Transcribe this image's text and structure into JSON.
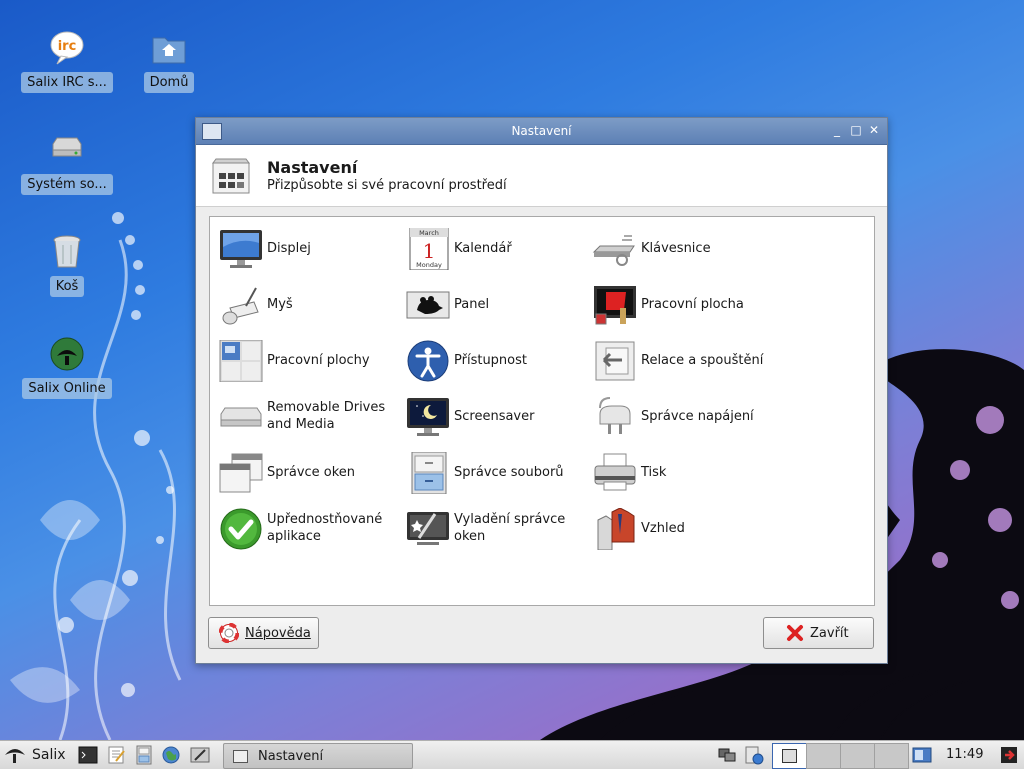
{
  "desktop": {
    "icons": [
      {
        "label": "Salix IRC s...",
        "icon": "irc-chat-icon"
      },
      {
        "label": "Domů",
        "icon": "home-folder-icon"
      },
      {
        "label": "Systém so...",
        "icon": "drive-icon"
      },
      {
        "label": "Koš",
        "icon": "trash-icon"
      },
      {
        "label": "Salix Online",
        "icon": "salix-online-icon"
      }
    ]
  },
  "window": {
    "title": "Nastavení",
    "controls": {
      "minimize": "_",
      "maximize": "□",
      "close": "✕"
    },
    "header": {
      "title": "Nastavení",
      "subtitle": "Přizpůsobte si své pracovní prostředí"
    },
    "items": [
      {
        "label": "Displej",
        "icon": "monitor-icon"
      },
      {
        "label": "Kalendář",
        "icon": "calendar-icon",
        "icon_month": "March",
        "icon_day": "1",
        "icon_weekday": "Monday"
      },
      {
        "label": "Klávesnice",
        "icon": "keyboard-icon"
      },
      {
        "label": "Myš",
        "icon": "mouse-icon"
      },
      {
        "label": "Panel",
        "icon": "panel-icon"
      },
      {
        "label": "Pracovní plocha",
        "icon": "desktop-icon"
      },
      {
        "label": "Pracovní plochy",
        "icon": "workspaces-icon"
      },
      {
        "label": "Přístupnost",
        "icon": "accessibility-icon"
      },
      {
        "label": "Relace a spouštění",
        "icon": "session-icon"
      },
      {
        "label": "Removable Drives and Media",
        "icon": "removable-drive-icon"
      },
      {
        "label": "Screensaver",
        "icon": "screensaver-icon"
      },
      {
        "label": "Správce napájení",
        "icon": "power-plug-icon"
      },
      {
        "label": "Správce oken",
        "icon": "window-manager-icon"
      },
      {
        "label": "Správce souborů",
        "icon": "file-manager-icon"
      },
      {
        "label": "Tisk",
        "icon": "printer-icon"
      },
      {
        "label": "Upřednostňované aplikace",
        "icon": "preferred-apps-icon"
      },
      {
        "label": "Vyladění správce oken",
        "icon": "wm-tweaks-icon"
      },
      {
        "label": "Vzhled",
        "icon": "appearance-icon"
      }
    ],
    "buttons": {
      "help": "Nápověda",
      "close": "Zavřít"
    }
  },
  "taskbar": {
    "menu_label": "Salix",
    "task_label": "Nastavení",
    "clock": "11:49"
  },
  "colors": {
    "titlebar": "#6a8cbe",
    "accent": "#3a66b0"
  }
}
